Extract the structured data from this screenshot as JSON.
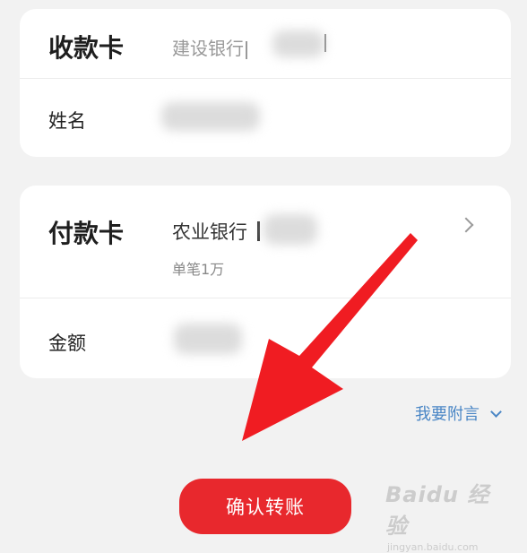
{
  "receive_card": {
    "title": "收款卡",
    "bank_name": "建设银行",
    "name_label": "姓名"
  },
  "pay_card": {
    "title": "付款卡",
    "bank_name": "农业银行",
    "limit": "单笔1万",
    "amount_label": "金额"
  },
  "note_link": {
    "label": "我要附言"
  },
  "confirm_button": {
    "label": "确认转账"
  },
  "watermark": {
    "main": "Baidu 经验",
    "sub": "jingyan.baidu.com"
  },
  "colors": {
    "accent_red": "#e8282d",
    "link_blue": "#4a86c5",
    "annotation_arrow": "#f01c22"
  }
}
